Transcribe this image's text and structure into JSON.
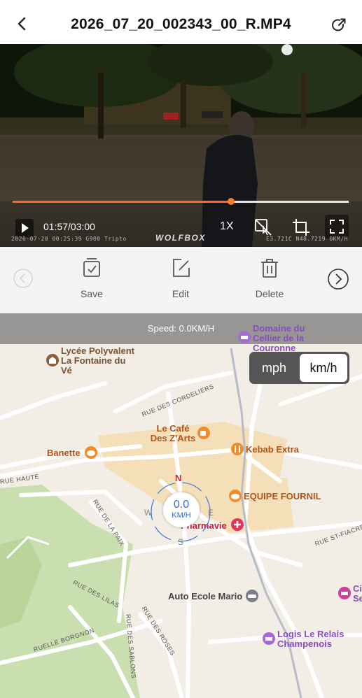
{
  "header": {
    "title": "2026_07_20_002343_00_R.MP4"
  },
  "video": {
    "time": "01:57/03:00",
    "playback_rate": "1X",
    "progress_fraction": 0.65,
    "stamp_left": "2026-07-20 00:25:39 G900 Tripto",
    "stamp_right": "E3.721C N48.7219 0KM/H",
    "watermark": "WOLFBOX"
  },
  "toolbar": {
    "save_label": "Save",
    "edit_label": "Edit",
    "delete_label": "Delete"
  },
  "map": {
    "speed_text": "Speed: 0.0KM/H",
    "units": {
      "mph": "mph",
      "kmh": "km/h",
      "selected": "km/h"
    },
    "dial": {
      "value": "0.0",
      "unit": "KM/H",
      "n": "N",
      "e": "E",
      "s": "S",
      "w": "W"
    },
    "pois": {
      "domaine": "Domaine du Cellier de la Couronne",
      "lycee": "Lycée Polyvalent La Fontaine du Vé",
      "cafe": "Le Café Des Z'Arts",
      "banette": "Banette",
      "kebab": "Kebab Extra",
      "fournil": "EQUIPE FOURNIL",
      "pharmavie": "Pharmavie",
      "auto_ecole": "Auto Ecole Mario",
      "logis": "Logis Le Relais Champenois",
      "ci": "Ci Se"
    },
    "streets": {
      "cordeliers": "RUE DES CORDELIERS",
      "haute": "RUE HAUTE",
      "paix": "RUE DE LA PAIX",
      "lilas": "RUE DES LILAS",
      "bourgnon": "RUELLE BORGNON",
      "roses": "RUE DES ROSES",
      "sablons": "RUE DES SABLONS",
      "fiacre": "RUE ST-FIACRE"
    }
  },
  "colors": {
    "accent": "#ff6a1a",
    "dial_blue": "#2d6fcf",
    "compass_red": "#e0202a"
  }
}
